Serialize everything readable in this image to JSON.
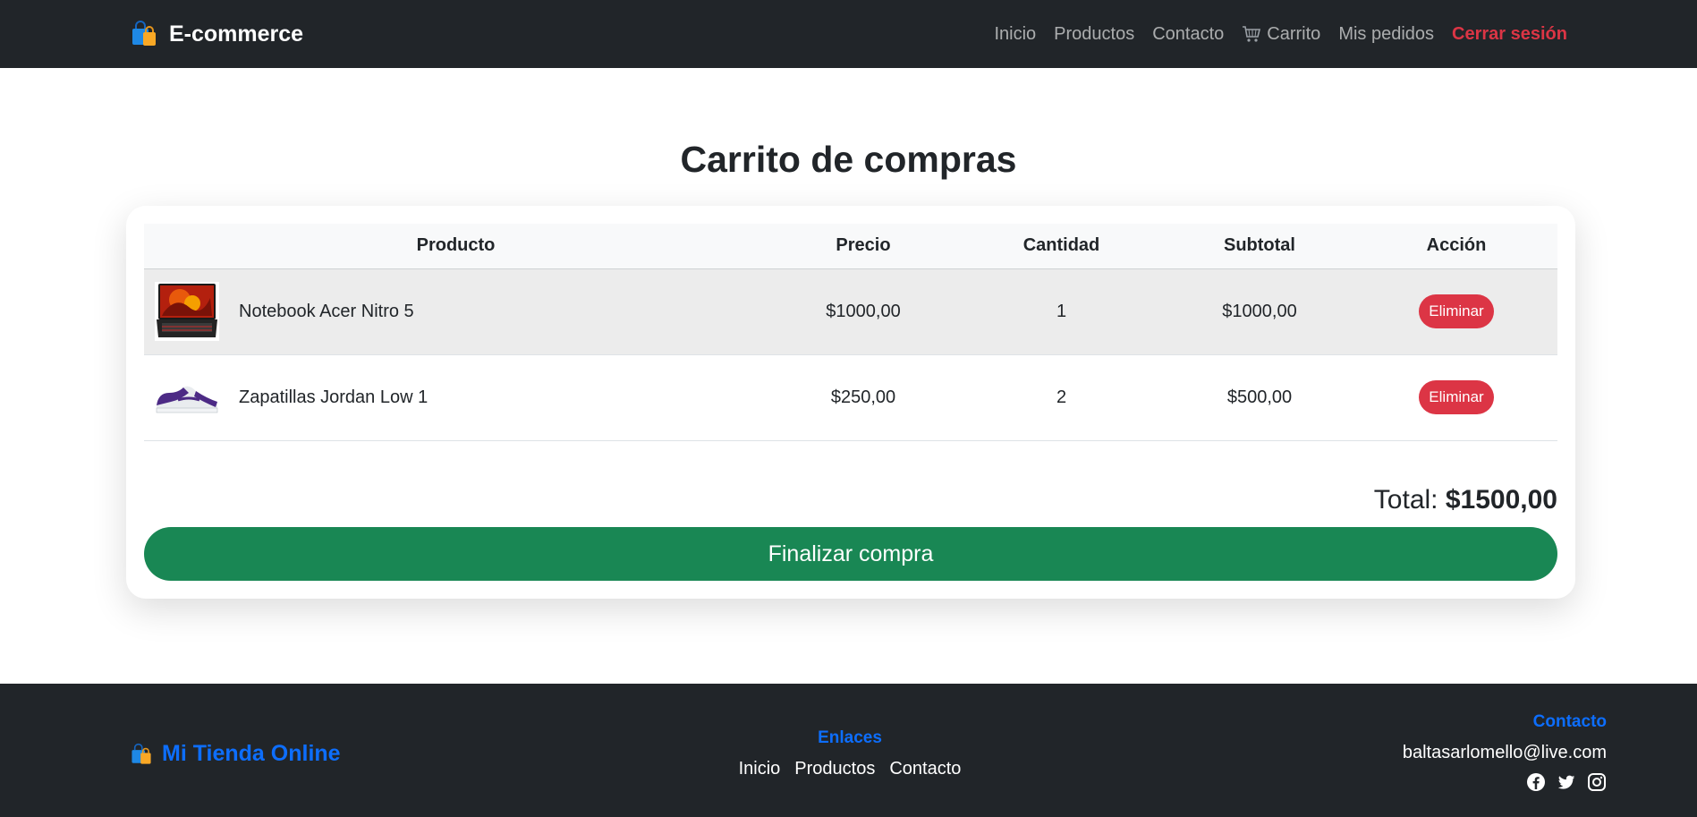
{
  "navbar": {
    "brand_icon": "shopping-bags-icon",
    "brand": "E-commerce",
    "links": [
      {
        "label": "Inicio"
      },
      {
        "label": "Productos"
      },
      {
        "label": "Contacto"
      },
      {
        "label": "Carrito",
        "icon": "shopping-cart-icon"
      },
      {
        "label": "Mis pedidos"
      },
      {
        "label": "Cerrar sesión",
        "color": "#dc3545"
      }
    ]
  },
  "main": {
    "title": "Carrito de compras",
    "table": {
      "headers": [
        "Producto",
        "Precio",
        "Cantidad",
        "Subtotal",
        "Acción"
      ],
      "rows": [
        {
          "image": "laptop-thumbnail",
          "name": "Notebook Acer Nitro 5",
          "price": "$1000,00",
          "quantity": "1",
          "subtotal": "$1000,00",
          "action": "Eliminar"
        },
        {
          "image": "sneaker-thumbnail",
          "name": "Zapatillas Jordan Low 1",
          "price": "$250,00",
          "quantity": "2",
          "subtotal": "$500,00",
          "action": "Eliminar"
        }
      ]
    },
    "total_label": "Total:",
    "total_value": "$1500,00",
    "checkout_label": "Finalizar compra"
  },
  "footer": {
    "brand_icon": "shopping-bags-icon",
    "brand": "Mi Tienda Online",
    "links_heading": "Enlaces",
    "links": [
      "Inicio",
      "Productos",
      "Contacto"
    ],
    "contact_heading": "Contacto",
    "email": "baltasarlomello@live.com",
    "social": [
      "facebook-icon",
      "twitter-icon",
      "instagram-icon"
    ]
  },
  "colors": {
    "navbar_bg": "#212529",
    "danger": "#dc3545",
    "success": "#198754",
    "primary": "#0d6efd"
  }
}
